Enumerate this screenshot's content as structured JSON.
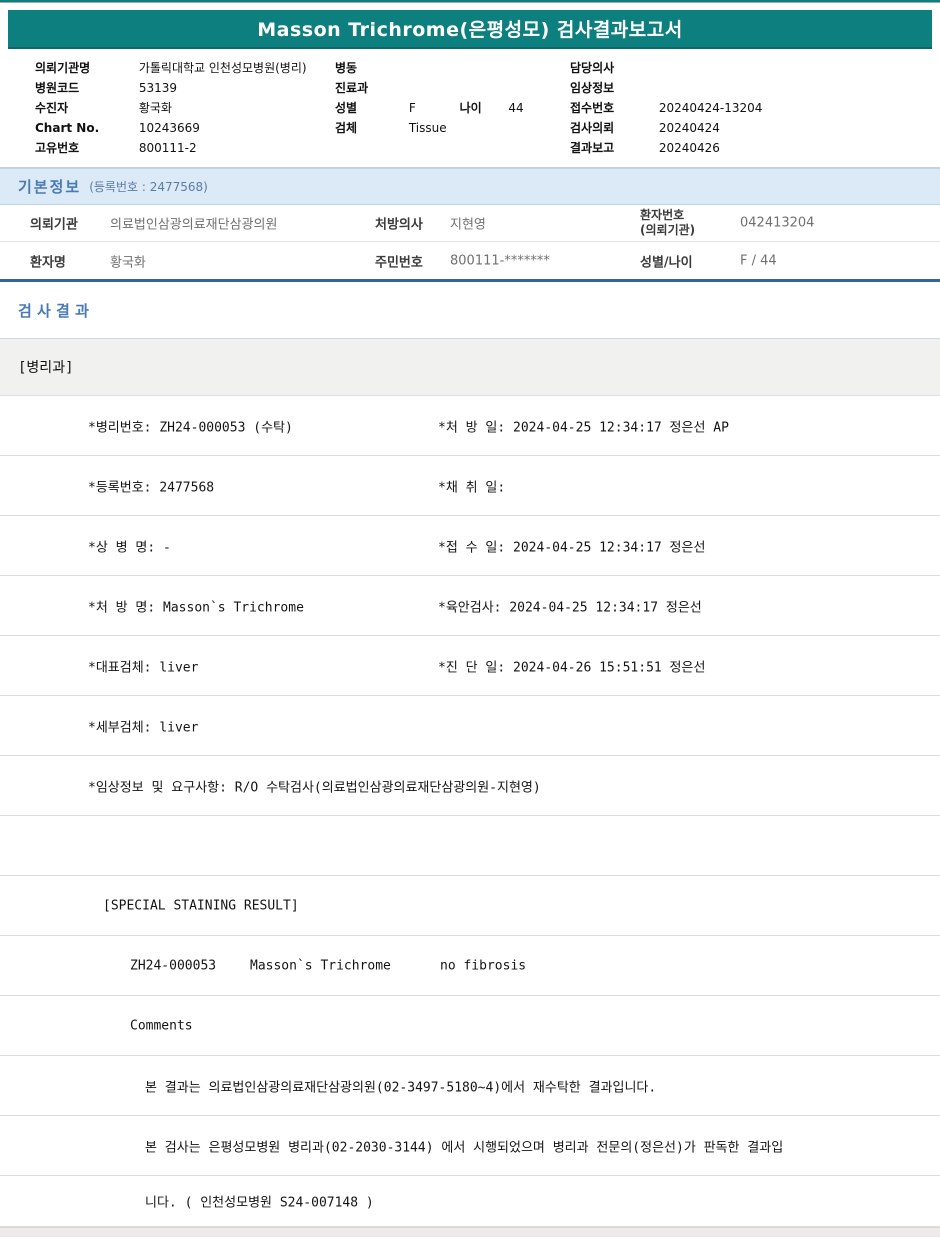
{
  "colors": {
    "teal_header": "#0E7F7F",
    "section_blue": "#4A7AB5",
    "basic_bar_bg": "#DCE9F6",
    "table_bottom_border": "#35639F",
    "dept_band_bg": "#F1F1EF"
  },
  "title": "Masson Trichrome(은평성모) 검사결과보고서",
  "patient_header": {
    "left": [
      {
        "label": "의뢰기관명",
        "value": "가톨릭대학교 인천성모병원(병리)"
      },
      {
        "label": "병원코드",
        "value": "53139"
      },
      {
        "label": "수진자",
        "value": "황국화"
      },
      {
        "label": "Chart No.",
        "value": "10243669"
      },
      {
        "label": "고유번호",
        "value": "800111-2"
      }
    ],
    "middle": {
      "ward": {
        "label": "병동",
        "value": ""
      },
      "dept": {
        "label": "진료과",
        "value": ""
      },
      "sex": {
        "label": "성별",
        "value": "F",
        "age_label": "나이",
        "age_value": "44"
      },
      "specimen": {
        "label": "검체",
        "value": "Tissue"
      }
    },
    "right": [
      {
        "label": "담당의사",
        "value": ""
      },
      {
        "label": "임상정보",
        "value": ""
      },
      {
        "label": "접수번호",
        "value": "20240424-13204"
      },
      {
        "label": "검사의뢰",
        "value": "20240424"
      },
      {
        "label": "결과보고",
        "value": "20240426"
      }
    ]
  },
  "basic_info": {
    "section_title": "기본정보",
    "section_subtitle": "(등록번호 : 2477568)",
    "row1": {
      "c1_label": "의뢰기관",
      "c1_value": "의료법인삼광의료재단삼광의원",
      "c2_label": "처방의사",
      "c2_value": "지현영",
      "c3_label": "환자번호\n(의뢰기관)",
      "c3_value": "042413204"
    },
    "row2": {
      "c1_label": "환자명",
      "c1_value": "황국화",
      "c2_label": "주민번호",
      "c2_value": "800111-*******",
      "c3_label": "성별/나이",
      "c3_value": "F / 44"
    }
  },
  "results": {
    "section_title": "검 사 결 과",
    "department": "[병리과]",
    "detail_rows": [
      {
        "left": "*병리번호: ZH24-000053 (수탁)",
        "right": "*처 방 일: 2024-04-25 12:34:17  정은선 AP"
      },
      {
        "left": "*등록번호: 2477568",
        "right": "*채 취 일:"
      },
      {
        "left": "*상 병 명: -",
        "right": "*접 수 일: 2024-04-25 12:34:17  정은선"
      },
      {
        "left": "*처 방 명: Masson`s Trichrome",
        "right": "*육안검사: 2024-04-25 12:34:17   정은선"
      },
      {
        "left": "*대표검체: liver",
        "right": "*진 단 일: 2024-04-26 15:51:51   정은선"
      },
      {
        "left": "*세부검체: liver",
        "right": ""
      }
    ],
    "clinical_info": "*임상정보 및 요구사항: R/O 수탁검사(의료법인삼광의료재단삼광의원-지현영)",
    "staining_header": "[SPECIAL STAINING RESULT]",
    "staining_row": {
      "id": "ZH24-000053",
      "stain": "Masson`s Trichrome",
      "result": "no fibrosis"
    },
    "comments_label": "Comments",
    "comment_lines": [
      "본 결과는 의료법인삼광의료재단삼광의원(02-3497-5180~4)에서 재수탁한 결과입니다.",
      "본 검사는 은평성모병원 병리과(02-2030-3144) 에서 시행되었으며 병리과 전문의(정은선)가 판독한 결과입",
      "니다. ( 인천성모병원 S24-007148 )"
    ]
  }
}
